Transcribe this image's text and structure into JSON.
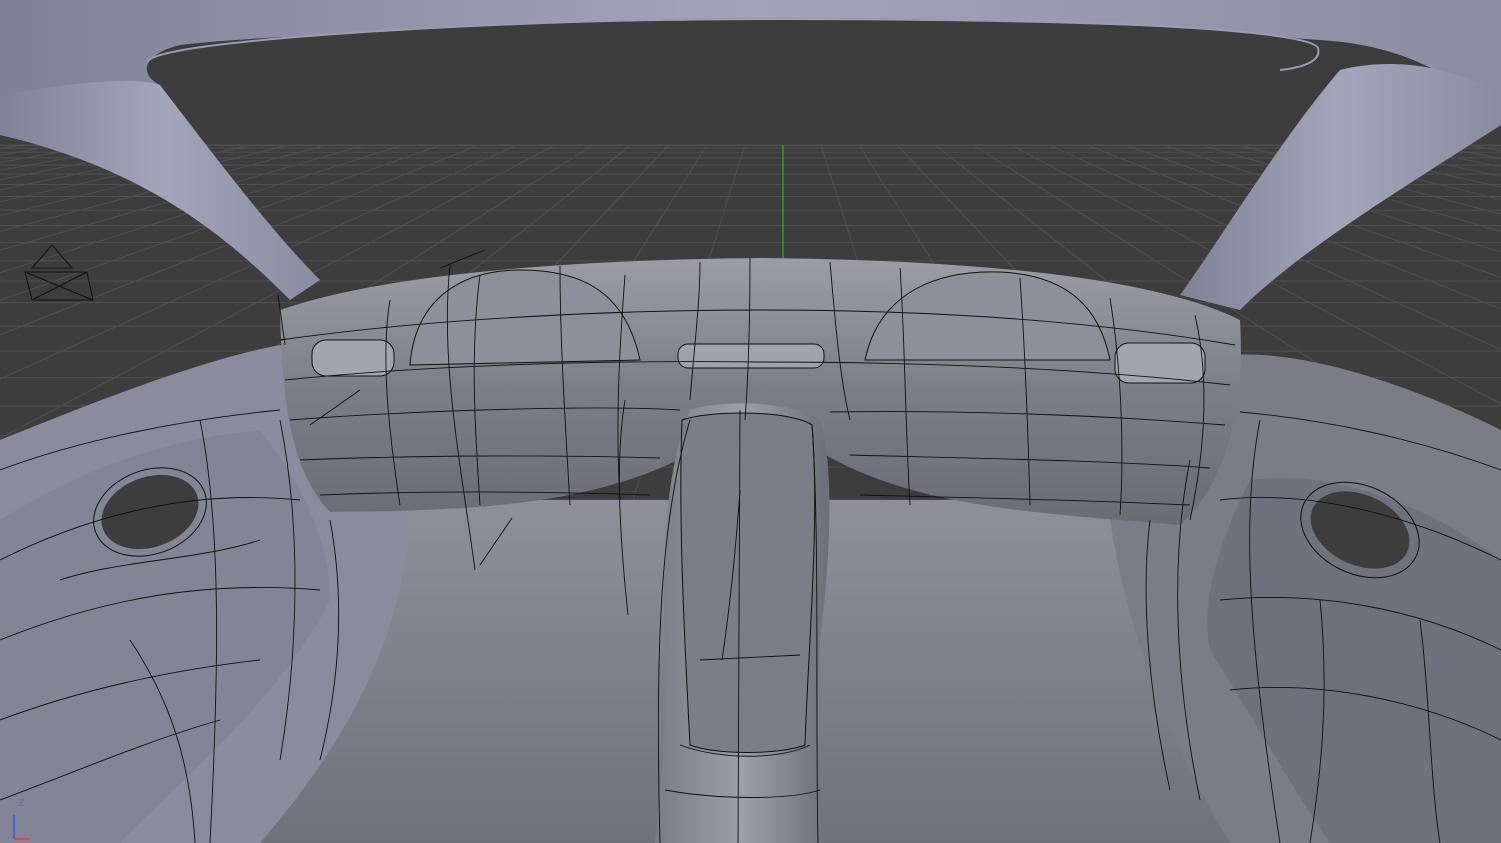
{
  "viewport": {
    "background_color": "#3d3d3d",
    "grid_color": "#4f4f4f",
    "y_axis_color": "#3fb63f",
    "model_color": "#8a8c99",
    "model_dark_color": "#6e7079",
    "wire_color": "#111111"
  },
  "axis_gizmo": {
    "z_label": "Z",
    "z_color": "#3355ff",
    "x_color": "#ff3333"
  },
  "objects": {
    "camera": "camera-icon",
    "car_interior": "car-interior-mesh"
  }
}
